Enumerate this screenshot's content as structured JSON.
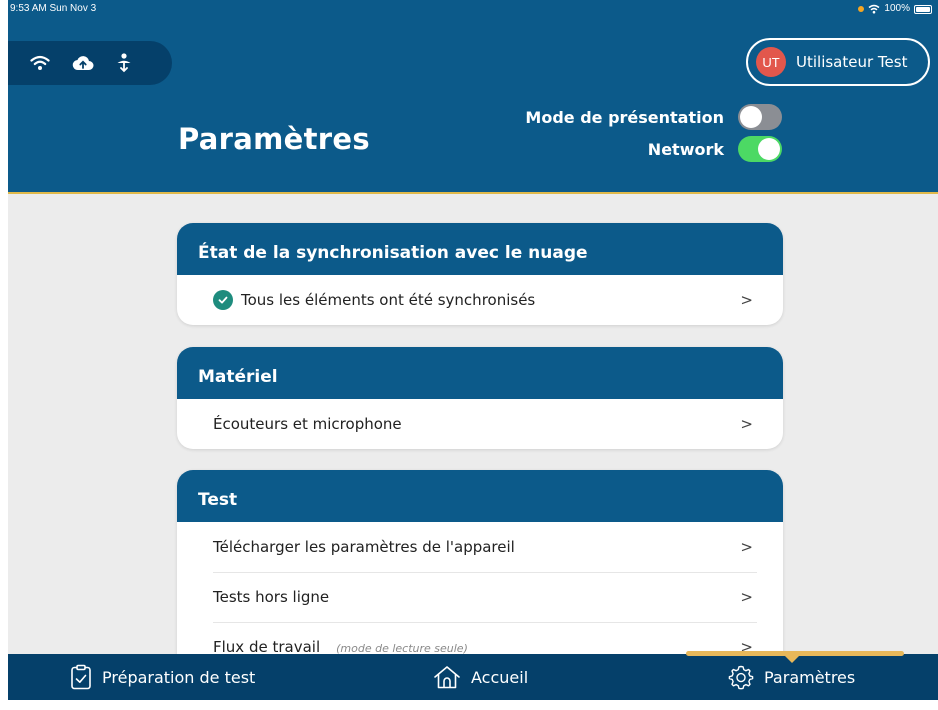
{
  "status_bar": {
    "time": "9:53 AM  Sun Nov 3",
    "battery": "100%"
  },
  "header": {
    "title": "Paramètres",
    "user": {
      "initials": "UT",
      "name": "Utilisateur Test"
    },
    "toggles": [
      {
        "label": "Mode de présentation",
        "state": "off"
      },
      {
        "label": "Network",
        "state": "on"
      }
    ],
    "icons": [
      "wifi-icon",
      "cloud-upload-icon",
      "download-person-icon"
    ]
  },
  "cards": {
    "sync": {
      "title": "État de la synchronisation avec le nuage",
      "rows": [
        {
          "label": "Tous les éléments ont été synchronisés",
          "chevron": ">"
        }
      ]
    },
    "hardware": {
      "title": "Matériel",
      "rows": [
        {
          "label": "Écouteurs et microphone",
          "chevron": ">"
        }
      ]
    },
    "test": {
      "title": "Test",
      "rows": [
        {
          "label": "Télécharger les paramètres de l'appareil",
          "chevron": ">"
        },
        {
          "label": "Tests hors ligne",
          "chevron": ">"
        },
        {
          "label": "Flux de travail",
          "note": "(mode de lecture seule)",
          "chevron": ">"
        }
      ]
    }
  },
  "tabbar": {
    "tabs": [
      {
        "label": "Préparation de test",
        "icon": "clipboard-check-icon"
      },
      {
        "label": "Accueil",
        "icon": "home-icon"
      },
      {
        "label": "Paramètres",
        "icon": "gear-icon",
        "active": true
      }
    ]
  },
  "colors": {
    "brand": "#0c5a8a",
    "brand_dark": "#05406a",
    "accent": "#e8b85a",
    "toggle_on": "#4cd964",
    "check": "#1e8c7e"
  }
}
